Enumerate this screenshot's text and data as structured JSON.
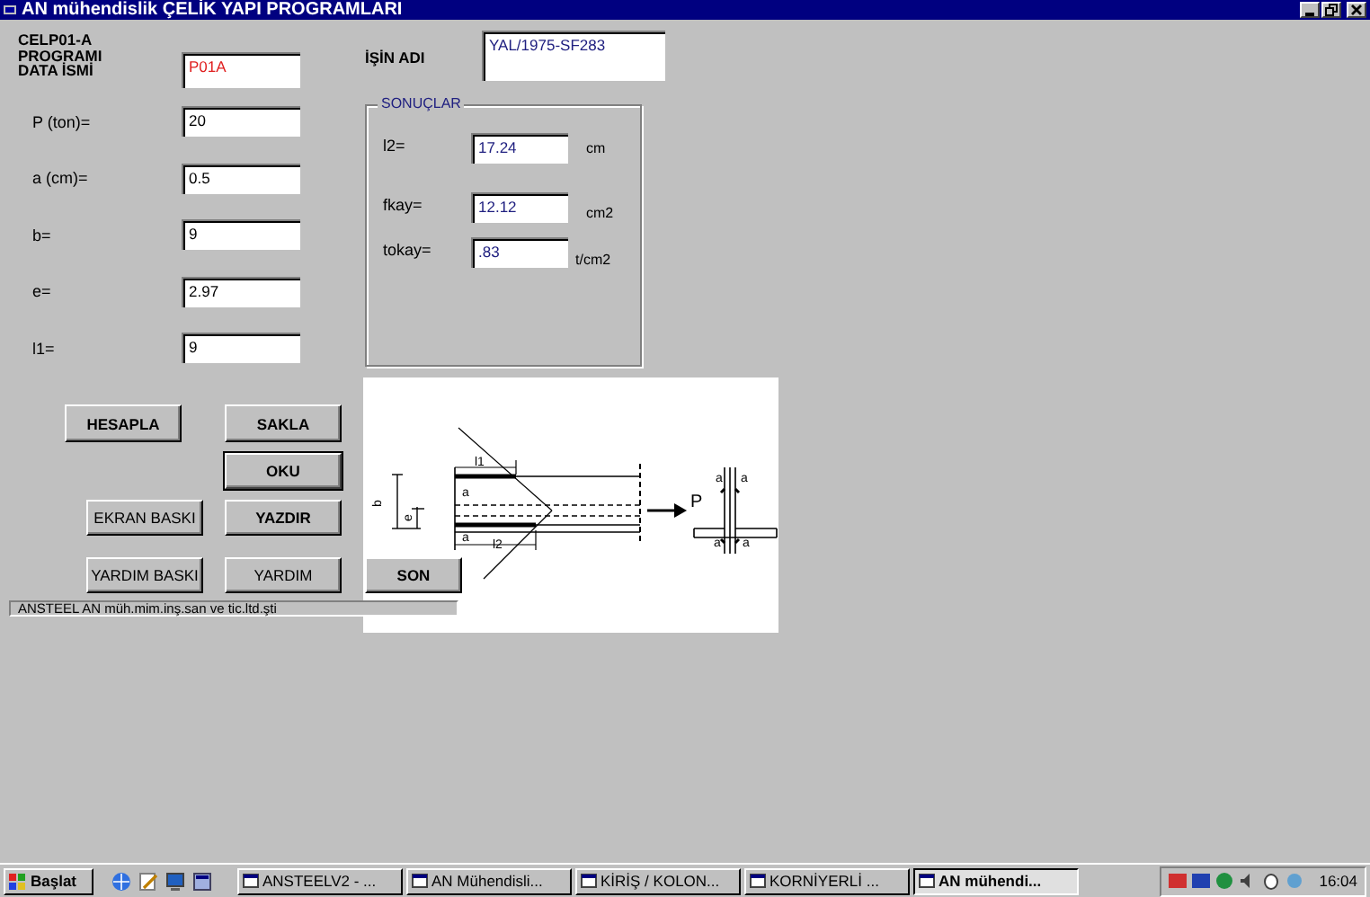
{
  "window": {
    "title": "AN mühendislik  ÇELİK YAPI PROGRAMLARI"
  },
  "program_label": {
    "lines": [
      "CELP01-A",
      "PROGRAMI",
      "DATA  İSMİ"
    ]
  },
  "data_name": {
    "value": "P01A"
  },
  "inputs": [
    {
      "label": "P (ton)=",
      "value": "20"
    },
    {
      "label": "a (cm)=",
      "value": "0.5"
    },
    {
      "label": "b=",
      "value": "9"
    },
    {
      "label": "e=",
      "value": "2.97"
    },
    {
      "label": "l1=",
      "value": "9"
    }
  ],
  "job": {
    "label": "İŞİN ADI",
    "value": "YAL/1975-SF283"
  },
  "results": {
    "title": "SONUÇLAR",
    "rows": [
      {
        "label": "l2=",
        "value": "17.24",
        "unit": "cm"
      },
      {
        "label": "fkay=",
        "value": "12.12",
        "unit": "cm2"
      },
      {
        "label": "tokay=",
        "value": ".83",
        "unit": "t/cm2"
      }
    ]
  },
  "buttons": [
    {
      "label": "HESAPLA",
      "kind": "command",
      "focused": false
    },
    {
      "label": "SAKLA",
      "kind": "command",
      "focused": false
    },
    {
      "label": "OKU",
      "kind": "command",
      "focused": true
    },
    {
      "label": "EKRAN BASKI",
      "kind": "print",
      "focused": false
    },
    {
      "label": "YAZDIR",
      "kind": "command",
      "focused": false
    },
    {
      "label": "YARDIM BASKI",
      "kind": "print",
      "focused": false
    },
    {
      "label": "YARDIM",
      "kind": "print",
      "focused": false
    }
  ],
  "exit_button": {
    "label": "SON"
  },
  "status": "ANSTEEL   AN müh.mim.inş.san ve tic.ltd.şti",
  "diagram": {
    "labels": [
      "b",
      "e",
      "l1",
      "a",
      "a",
      "l2",
      "P",
      "a",
      "a",
      "a",
      "a"
    ]
  },
  "taskbar": {
    "start": "Başlat",
    "tasks": [
      {
        "label": "ANSTEELV2 - ...",
        "selected": false
      },
      {
        "label": "AN Mühendisli...",
        "selected": false
      },
      {
        "label": "KİRİŞ / KOLON...",
        "selected": false
      },
      {
        "label": "KORNİYERLİ ...",
        "selected": false
      },
      {
        "label": "AN mühendi...",
        "selected": true
      }
    ],
    "clock": "16:04"
  }
}
